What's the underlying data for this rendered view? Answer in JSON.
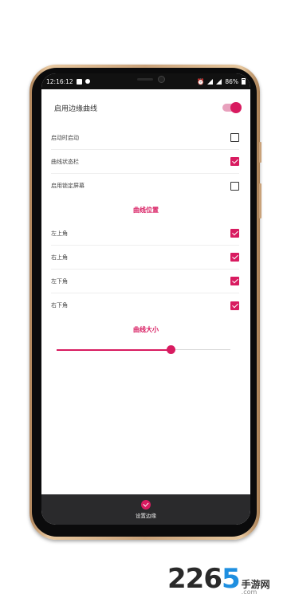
{
  "status_bar": {
    "time": "12:16:12",
    "battery_percent": "86%"
  },
  "settings": {
    "main_toggle": {
      "label": "启用边缘曲线",
      "on": true
    },
    "options": [
      {
        "label": "启动时启动",
        "checked": false
      },
      {
        "label": "曲线状态栏",
        "checked": true
      },
      {
        "label": "启用锁定屏幕",
        "checked": false
      }
    ],
    "position_section_title": "曲线位置",
    "positions": [
      {
        "label": "左上角",
        "checked": true
      },
      {
        "label": "右上角",
        "checked": true
      },
      {
        "label": "左下角",
        "checked": true
      },
      {
        "label": "右下角",
        "checked": true
      }
    ],
    "size_section_title": "曲线大小",
    "size_slider_value": 0.66
  },
  "bottom_bar": {
    "label": "设置边缘"
  },
  "watermark": {
    "number_main": "226",
    "number_accent": "5",
    "chinese": "手游网",
    "url": ".com"
  },
  "colors": {
    "accent": "#d81b60",
    "bottom_bar_bg": "#2a2a2c",
    "phone_frame": "#c9a27a"
  }
}
